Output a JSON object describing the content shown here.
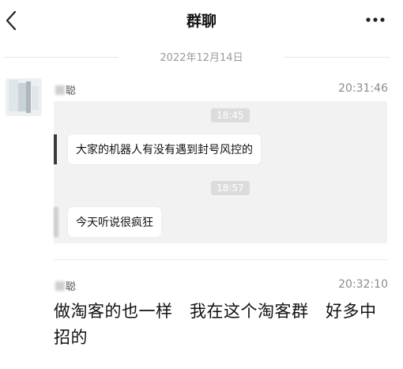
{
  "header": {
    "title": "群聊",
    "back_icon": "chevron-left-icon",
    "more_icon": "ellipsis-icon"
  },
  "date_divider": "2022年12月14日",
  "messages": [
    {
      "sender_name": "聪",
      "time": "20:31:46",
      "chat_record": [
        {
          "timestamp": "18:45",
          "text": "大家的机器人有没有遇到封号风控的"
        },
        {
          "timestamp": "18:57",
          "text": "今天听说很疯狂"
        }
      ]
    },
    {
      "sender_name": "聪",
      "time": "20:32:10",
      "text": "做淘客的也一样   我在这个淘客群   好多中招的"
    }
  ],
  "colors": {
    "background": "#ffffff",
    "card": "#f2f2f2",
    "timestamp_chip": "#dcdcdc",
    "muted_text": "#8a8a8a"
  }
}
